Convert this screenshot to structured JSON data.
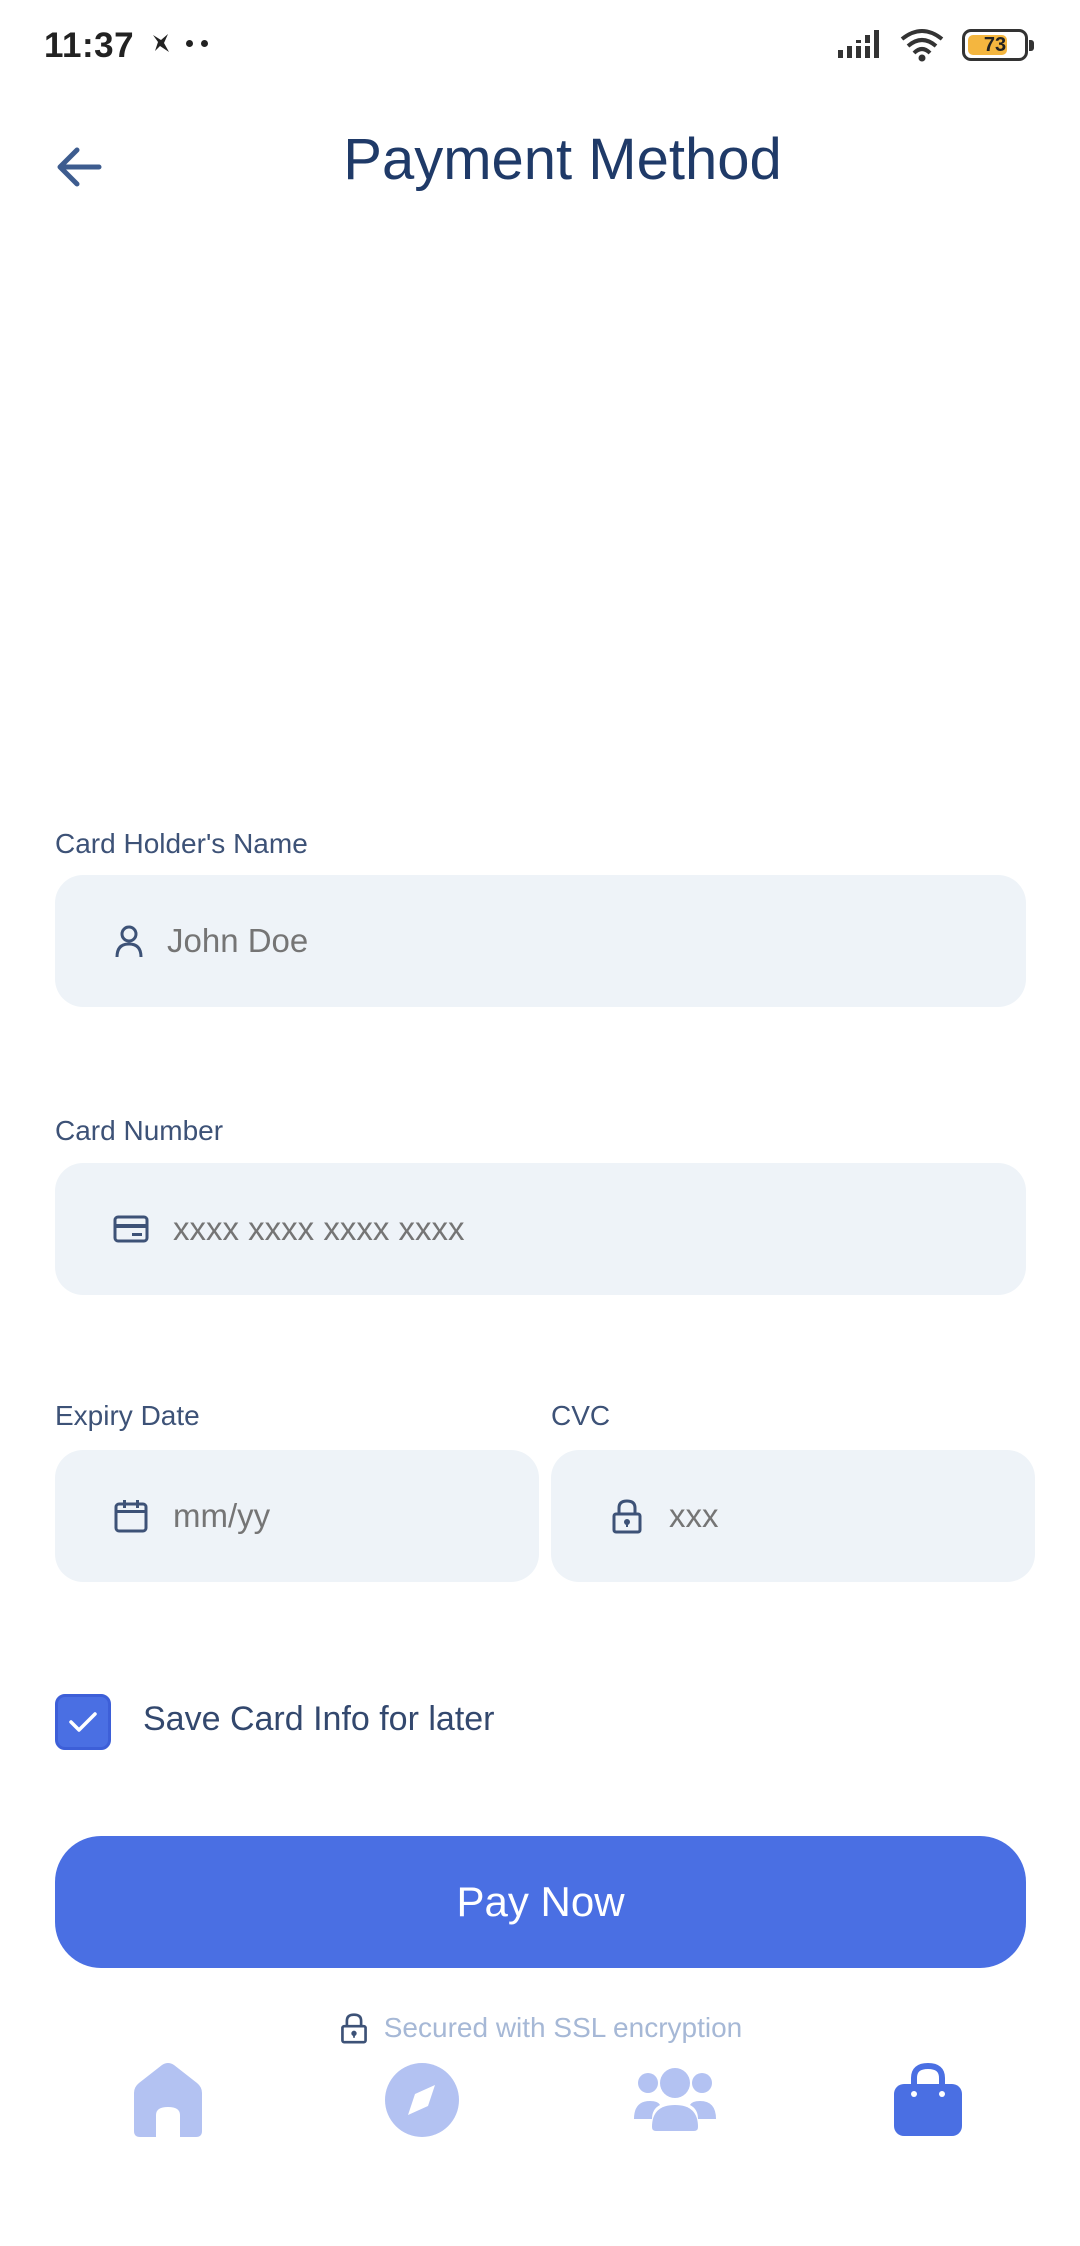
{
  "status_bar": {
    "time": "11:37",
    "battery_level": "73",
    "battery_fraction": 0.73
  },
  "header": {
    "title": "Payment Method",
    "back_icon": "arrow-left-icon"
  },
  "form": {
    "card_holder": {
      "label": "Card Holder's Name",
      "placeholder": "John Doe",
      "icon": "user-icon"
    },
    "card_number": {
      "label": "Card Number",
      "placeholder": "xxxx xxxx xxxx xxxx",
      "icon": "credit-card-icon"
    },
    "expiry": {
      "label": "Expiry Date",
      "placeholder": "mm/yy",
      "icon": "calendar-icon"
    },
    "cvc": {
      "label": "CVC",
      "placeholder": "xxx",
      "icon": "lock-icon"
    },
    "save_card": {
      "label": "Save Card Info for later",
      "checked": true
    },
    "pay_button": "Pay Now",
    "secured_text": "Secured with SSL encryption"
  },
  "bottom_nav": {
    "items": [
      {
        "icon": "home-icon",
        "active": false
      },
      {
        "icon": "compass-icon",
        "active": false
      },
      {
        "icon": "people-icon",
        "active": false
      },
      {
        "icon": "shopping-bag-icon",
        "active": true
      }
    ]
  },
  "colors": {
    "primary": "#4a6fe3",
    "title": "#1f3a68",
    "label": "#3d5277",
    "input_bg": "#eef3f8",
    "placeholder": "#9aa1a9",
    "nav_inactive": "#b3c2f2",
    "secured_text": "#a6b8d6"
  }
}
